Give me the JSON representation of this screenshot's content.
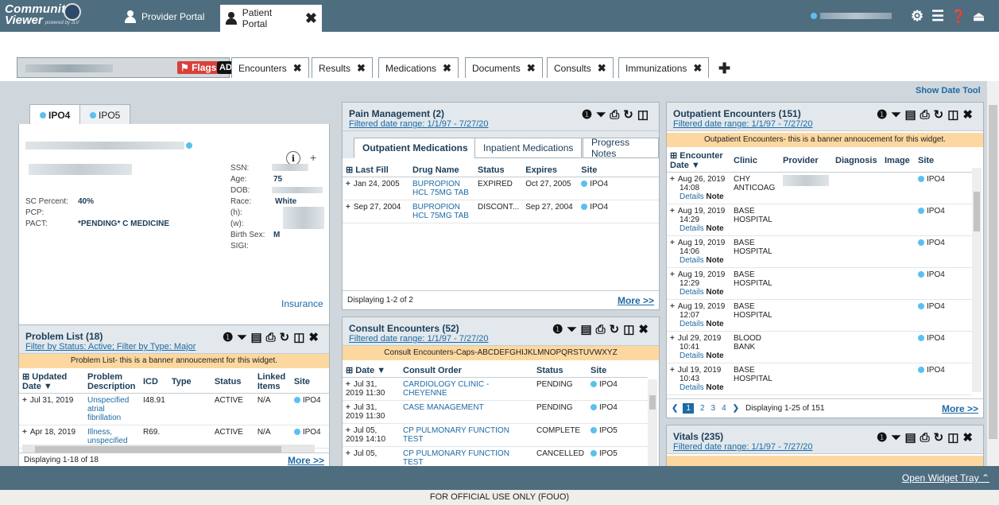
{
  "app": {
    "title_line1": "Community",
    "title_line2": "Viewer",
    "powered": "powered by JLV"
  },
  "portal_tabs": {
    "provider": "Provider Portal",
    "patient": "Patient Portal"
  },
  "patient": {
    "flags": "Flags",
    "ad": "AD"
  },
  "tabs": [
    {
      "label": "Encounters"
    },
    {
      "label": "Results"
    },
    {
      "label": "Medications"
    },
    {
      "label": "Documents"
    },
    {
      "label": "Consults"
    },
    {
      "label": "Immunizations"
    }
  ],
  "show_date_tool": "Show Date Tool",
  "demographics": {
    "site_tabs": [
      "IPO4",
      "IPO5"
    ],
    "ssn_label": "SSN:",
    "age_label": "Age:",
    "age_value": "75",
    "dob_label": "DOB:",
    "race_label": "Race:",
    "race_value": "White",
    "h_label": "(h):",
    "w_label": "(w):",
    "birth_sex_label": "Birth Sex:",
    "birth_sex_value": "M",
    "sigi_label": "SIGI:",
    "sc_label": "SC Percent:",
    "sc_value": "40%",
    "pcp_label": "PCP:",
    "pact_label": "PACT:",
    "pact_value": "*PENDING* C MEDICINE",
    "insurance": "Insurance",
    "info_icon": "i",
    "plus": "+"
  },
  "problem_list": {
    "title": "Problem List (18)",
    "subtitle": "Filter by Status: Active; Filter by Type: Major",
    "banner": "Problem List- this is a banner annoucement for this widget.",
    "headers": [
      "Updated Date",
      "Problem Description",
      "ICD",
      "Type",
      "Status",
      "Linked Items",
      "Site"
    ],
    "rows": [
      {
        "date": "Jul 31, 2019",
        "desc": "Unspecified atrial fibrillation",
        "icd": "I48.91",
        "type": "",
        "status": "ACTIVE",
        "linked": "N/A",
        "site": "IPO4"
      },
      {
        "date": "Apr 18, 2019",
        "desc": "Illness, unspecified",
        "icd": "R69.",
        "type": "",
        "status": "ACTIVE",
        "linked": "N/A",
        "site": "IPO4"
      }
    ],
    "footer": "Displaying 1-18 of 18",
    "more": "More >>"
  },
  "pain": {
    "title": "Pain Management (2)",
    "subtitle": "Filtered date range: 1/1/97 - 7/27/20",
    "subtabs": [
      "Outpatient Medications",
      "Inpatient Medications",
      "Progress Notes"
    ],
    "headers": [
      "Last Fill",
      "Drug Name",
      "Status",
      "Expires",
      "Site"
    ],
    "rows": [
      {
        "fill": "Jan 24, 2005",
        "drug": "BUPROPION HCL 75MG TAB",
        "status": "EXPIRED",
        "expires": "Oct 27, 2005",
        "site": "IPO4"
      },
      {
        "fill": "Sep 27, 2004",
        "drug": "BUPROPION HCL 75MG TAB",
        "status": "DISCONT...",
        "expires": "Sep 27, 2004",
        "site": "IPO4"
      }
    ],
    "footer": "Displaying 1-2 of 2",
    "more": "More >>"
  },
  "consult": {
    "title": "Consult Encounters (52)",
    "subtitle": "Filtered date range: 1/1/97 - 7/27/20",
    "banner": "Consult Encounters-Caps-ABCDEFGHIJKLMNOPQRSTUVWXYZ",
    "headers": [
      "Date",
      "Consult Order",
      "Status",
      "Site"
    ],
    "rows": [
      {
        "date": "Jul 31, 2019 11:30",
        "order": "CARDIOLOGY CLINIC - CHEYENNE",
        "status": "PENDING",
        "site": "IPO4"
      },
      {
        "date": "Jul 31, 2019 11:30",
        "order": "CASE MANAGEMENT",
        "status": "PENDING",
        "site": "IPO4"
      },
      {
        "date": "Jul 05, 2019 14:10",
        "order": "CP PULMONARY FUNCTION TEST",
        "status": "COMPLETE",
        "site": "IPO5"
      },
      {
        "date": "Jul 05,",
        "order": "CP PULMONARY FUNCTION TEST",
        "status": "CANCELLED",
        "site": "IPO5"
      }
    ]
  },
  "outpatient": {
    "title": "Outpatient Encounters (151)",
    "subtitle": "Filtered date range: 1/1/97 - 7/27/20",
    "banner": "Outpatient Encounters- this is a banner annoucement for this widget.",
    "headers": [
      "Encounter Date",
      "Clinic",
      "Provider",
      "Diagnosis",
      "Image",
      "Site"
    ],
    "details": "Details",
    "note": "Note",
    "rows": [
      {
        "date": "Aug 26, 2019",
        "time": "14:08",
        "clinic": "CHY ANTICOAG",
        "site": "IPO4"
      },
      {
        "date": "Aug 19, 2019",
        "time": "14:29",
        "clinic": "BASE HOSPITAL",
        "site": "IPO4"
      },
      {
        "date": "Aug 19, 2019",
        "time": "14:06",
        "clinic": "BASE HOSPITAL",
        "site": "IPO4"
      },
      {
        "date": "Aug 19, 2019",
        "time": "12:29",
        "clinic": "BASE HOSPITAL",
        "site": "IPO4"
      },
      {
        "date": "Aug 19, 2019",
        "time": "12:07",
        "clinic": "BASE HOSPITAL",
        "site": "IPO4"
      },
      {
        "date": "Jul 29, 2019",
        "time": "10:41",
        "clinic": "BLOOD BANK",
        "site": "IPO4"
      },
      {
        "date": "Jul 19, 2019",
        "time": "10:43",
        "clinic": "BASE HOSPITAL",
        "site": "IPO4"
      }
    ],
    "pages": [
      "1",
      "2",
      "3",
      "4"
    ],
    "footer": "Displaying 1-25 of 151",
    "more": "More >>"
  },
  "vitals": {
    "title": "Vitals (235)",
    "subtitle": "Filtered date range: 1/1/97 - 7/27/20"
  },
  "open_widget_tray": "Open Widget Tray",
  "footer": "FOR OFFICIAL USE ONLY (FOUO)"
}
